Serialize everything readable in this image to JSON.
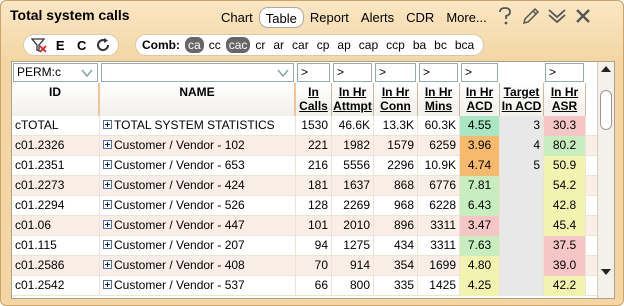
{
  "title": "Total system calls",
  "menu": [
    "Chart",
    "Table",
    "Report",
    "Alerts",
    "CDR",
    "More..."
  ],
  "active_menu": "Table",
  "toolbar_icons": [
    "help-icon",
    "edit-icon",
    "collapse-icon",
    "close-icon"
  ],
  "actions": [
    "filter-clear-icon",
    "E",
    "C",
    "refresh-icon"
  ],
  "comb": {
    "label": "Comb:",
    "options": [
      "ca",
      "cc",
      "cac",
      "cr",
      "ar",
      "car",
      "cp",
      "ap",
      "cap",
      "ccp",
      "ba",
      "bc",
      "bca"
    ],
    "selected": [
      "ca",
      "cac"
    ]
  },
  "filters": {
    "id": "PERM:c",
    "name": "",
    "calls": ">",
    "attempt": ">",
    "conn": ">",
    "mins": ">",
    "acd": ">",
    "target": "",
    "asr": ">"
  },
  "columns": [
    {
      "key": "id",
      "label": "ID"
    },
    {
      "key": "name",
      "label": "NAME"
    },
    {
      "key": "calls",
      "label": "In Calls"
    },
    {
      "key": "attempt",
      "label": "In Hr Attmpt"
    },
    {
      "key": "conn",
      "label": "In Hr Conn"
    },
    {
      "key": "mins",
      "label": "In Hr Mins"
    },
    {
      "key": "acd",
      "label": "In Hr ACD"
    },
    {
      "key": "target",
      "label": "Target In ACD"
    },
    {
      "key": "asr",
      "label": "In Hr ASR"
    }
  ],
  "rows": [
    {
      "id": "cTOTAL",
      "name": "TOTAL SYSTEM STATISTICS",
      "calls": "1530",
      "attempt": "46.6K",
      "conn": "13.3K",
      "mins": "60.3K",
      "acd": "4.55",
      "acd_color": "#a8e6c4",
      "target": "3",
      "asr": "30.3",
      "asr_color": "#f6c6c6"
    },
    {
      "id": "c01.2326",
      "name": "Customer / Vendor - 102",
      "calls": "221",
      "attempt": "1982",
      "conn": "1579",
      "mins": "6259",
      "acd": "3.96",
      "acd_color": "#f7b96b",
      "target": "4",
      "asr": "80.2",
      "asr_color": "#c8eec0"
    },
    {
      "id": "c01.2351",
      "name": "Customer / Vendor - 653",
      "calls": "216",
      "attempt": "5556",
      "conn": "2296",
      "mins": "10.9K",
      "acd": "4.74",
      "acd_color": "#f7b96b",
      "target": "5",
      "asr": "50.9",
      "asr_color": "#f3f3b0"
    },
    {
      "id": "c01.2273",
      "name": "Customer / Vendor - 424",
      "calls": "181",
      "attempt": "1637",
      "conn": "868",
      "mins": "6776",
      "acd": "7.81",
      "acd_color": "#c8eec0",
      "target": "",
      "asr": "54.2",
      "asr_color": "#f3f3b0"
    },
    {
      "id": "c01.2294",
      "name": "Customer / Vendor - 526",
      "calls": "128",
      "attempt": "2269",
      "conn": "968",
      "mins": "6228",
      "acd": "6.43",
      "acd_color": "#c8eec0",
      "target": "",
      "asr": "42.8",
      "asr_color": "#f3f3b0"
    },
    {
      "id": "c01.06",
      "name": "Customer / Vendor - 447",
      "calls": "101",
      "attempt": "2010",
      "conn": "896",
      "mins": "3311",
      "acd": "3.47",
      "acd_color": "#f6c6c6",
      "target": "",
      "asr": "45.4",
      "asr_color": "#f3f3b0"
    },
    {
      "id": "c01.115",
      "name": "Customer / Vendor - 207",
      "calls": "94",
      "attempt": "1275",
      "conn": "434",
      "mins": "3311",
      "acd": "7.63",
      "acd_color": "#c8eec0",
      "target": "",
      "asr": "37.5",
      "asr_color": "#f6c6c6"
    },
    {
      "id": "c01.2586",
      "name": "Customer / Vendor - 408",
      "calls": "70",
      "attempt": "914",
      "conn": "354",
      "mins": "1699",
      "acd": "4.80",
      "acd_color": "#f3f3b0",
      "target": "",
      "asr": "39.0",
      "asr_color": "#f6c6c6"
    },
    {
      "id": "c01.2542",
      "name": "Customer / Vendor - 537",
      "calls": "66",
      "attempt": "800",
      "conn": "335",
      "mins": "1425",
      "acd": "4.25",
      "acd_color": "#f3f3b0",
      "target": "",
      "asr": "42.2",
      "asr_color": "#f3f3b0"
    }
  ],
  "target_col_color": "#e8e8e8"
}
